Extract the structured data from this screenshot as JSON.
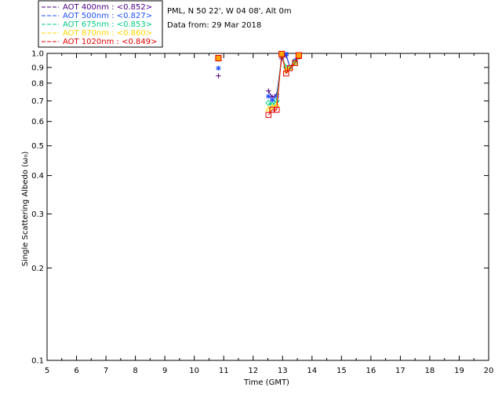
{
  "chart_data": {
    "type": "scatter",
    "title_lines": [
      "PML, N 50 22', W 04 08', Alt 0m",
      "Data from: 29 Mar 2018"
    ],
    "xlabel": "Time (GMT)",
    "ylabel": "Single Scattering Albedo (ω₀)",
    "xlim": [
      5,
      20
    ],
    "ylim": [
      0.1,
      1.0
    ],
    "yscale": "log",
    "xticks": [
      5,
      6,
      7,
      8,
      9,
      10,
      11,
      12,
      13,
      14,
      15,
      16,
      17,
      18,
      19,
      20
    ],
    "yticks": [
      {
        "value": 0.1,
        "label": "0.1"
      },
      {
        "value": 0.2,
        "label": "0.2"
      },
      {
        "value": 0.3,
        "label": "0.3"
      },
      {
        "value": 0.4,
        "label": "0.4"
      },
      {
        "value": 0.5,
        "label": "0.5"
      },
      {
        "value": 0.6,
        "label": "0.6"
      },
      {
        "value": 0.7,
        "label": "0.7"
      },
      {
        "value": 0.8,
        "label": "0.8"
      },
      {
        "value": 0.9,
        "label": "0.9"
      },
      {
        "value": 1.0,
        "label": "1.0"
      }
    ],
    "legend_position": "top-left (outside plot)",
    "series": [
      {
        "name": "AOT  400nm : <0.852>",
        "color": "#4b0082",
        "marker": "plus",
        "points": [
          [
            10.82,
            0.845
          ],
          [
            12.52,
            0.755
          ],
          [
            12.65,
            0.72
          ],
          [
            12.8,
            0.735
          ],
          [
            12.97,
            0.96
          ],
          [
            13.12,
            0.985
          ],
          [
            13.25,
            0.9
          ],
          [
            13.42,
            0.95
          ],
          [
            13.55,
            0.985
          ]
        ]
      },
      {
        "name": "AOT  500nm : <0.827>",
        "color": "#1f4fff",
        "marker": "asterisk",
        "points": [
          [
            10.82,
            0.895
          ],
          [
            12.52,
            0.725
          ],
          [
            12.65,
            0.705
          ],
          [
            12.8,
            0.725
          ],
          [
            12.97,
            0.98
          ],
          [
            13.12,
            0.995
          ],
          [
            13.25,
            0.9
          ],
          [
            13.42,
            0.945
          ],
          [
            13.55,
            0.98
          ]
        ]
      },
      {
        "name": "AOT  675nm : <0.853>",
        "color": "#00cc88",
        "marker": "diamond",
        "points": [
          [
            10.82,
            0.96
          ],
          [
            12.52,
            0.69
          ],
          [
            12.65,
            0.68
          ],
          [
            12.8,
            0.7
          ],
          [
            12.97,
            0.985
          ],
          [
            13.12,
            0.9
          ],
          [
            13.25,
            0.9
          ],
          [
            13.42,
            0.935
          ],
          [
            13.55,
            0.975
          ]
        ]
      },
      {
        "name": "AOT  870nm : <0.860>",
        "color": "#ffd700",
        "marker": "triangle",
        "points": [
          [
            10.82,
            0.965
          ],
          [
            12.52,
            0.66
          ],
          [
            12.65,
            0.67
          ],
          [
            12.8,
            0.68
          ],
          [
            12.97,
            0.99
          ],
          [
            13.12,
            0.88
          ],
          [
            13.25,
            0.9
          ],
          [
            13.42,
            0.93
          ],
          [
            13.55,
            0.98
          ]
        ]
      },
      {
        "name": "AOT 1020nm : <0.849>",
        "color": "#dd0000",
        "marker": "square",
        "points": [
          [
            10.82,
            0.965
          ],
          [
            12.52,
            0.63
          ],
          [
            12.65,
            0.655
          ],
          [
            12.8,
            0.655
          ],
          [
            12.97,
            0.995
          ],
          [
            13.12,
            0.86
          ],
          [
            13.25,
            0.895
          ],
          [
            13.42,
            0.93
          ],
          [
            13.55,
            0.98
          ]
        ]
      }
    ]
  },
  "overlay_marker": {
    "color": "#ffa500",
    "points": [
      [
        10.82,
        0.965
      ],
      [
        12.97,
        0.995
      ],
      [
        13.55,
        0.985
      ]
    ]
  }
}
